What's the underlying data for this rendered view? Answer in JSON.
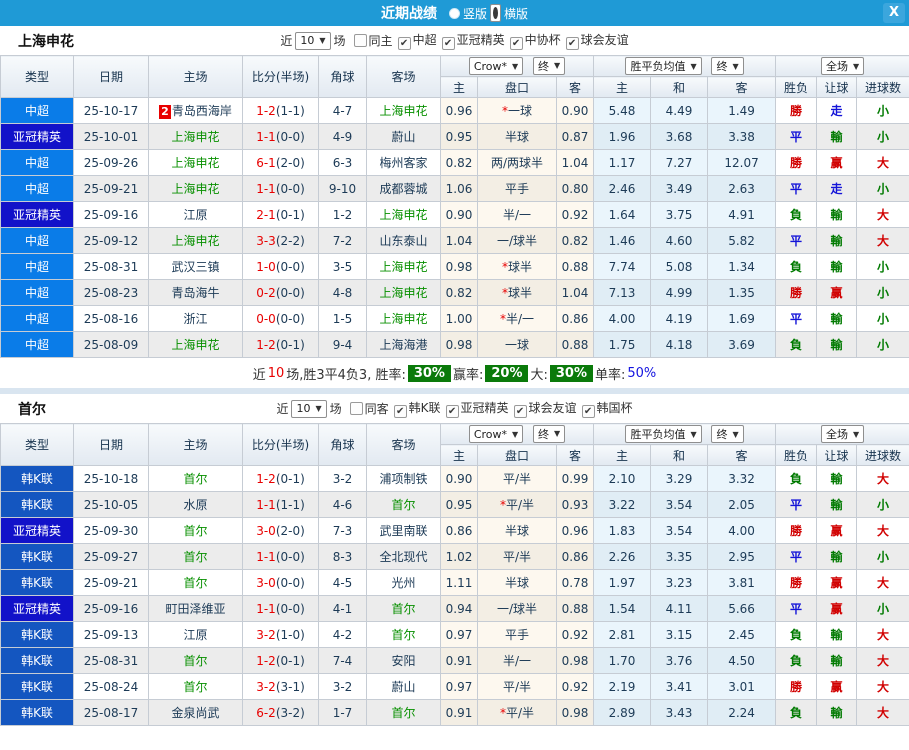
{
  "icons": {
    "dropdown_arrow": "▼",
    "close": "X",
    "check": "✔"
  },
  "topbar": {
    "title": "近期战绩",
    "vertical_label": "竖版",
    "horizontal_label": "横版"
  },
  "filter": {
    "near": "近",
    "count": "10",
    "games": "场"
  },
  "columns": {
    "type": "类型",
    "date": "日期",
    "home": "主场",
    "score": "比分(半场)",
    "corner": "角球",
    "away": "客场",
    "bookmaker": "Crow*",
    "final": "终",
    "mean": "胜平负均值",
    "scope": "全场",
    "odds_home": "主",
    "handicap": "盘口",
    "odds_away": "客",
    "mean_home": "主",
    "mean_draw": "和",
    "mean_away": "客",
    "result": "胜负",
    "handicap_result": "让球",
    "goals": "进球数"
  },
  "colors": {
    "topbar": "#1f9ad6",
    "types": {
      "中超": "#0a7ce8",
      "亚冠精英": "#1212c9",
      "韩K联": "#1456c0"
    },
    "result": {
      "勝": "#d10000",
      "赢": "#d10000",
      "大": "#d10000",
      "平": "#1414d8",
      "走": "#1414d8",
      "負": "#007a00",
      "輸": "#007a00",
      "小": "#007a00"
    }
  },
  "sections": [
    {
      "team": "上海申花",
      "filter": {
        "same": "同主",
        "same_checked": false,
        "leagues": [
          "中超",
          "亚冠精英",
          "中协杯",
          "球会友谊"
        ]
      },
      "rows": [
        {
          "type": "中超",
          "date": "25-10-17",
          "badge": "2",
          "home": "青岛西海岸",
          "hg": false,
          "ft": "1-2",
          "ht": "(1-1)",
          "corner": "4-7",
          "away": "上海申花",
          "ag": true,
          "h": "0.96",
          "star": true,
          "hcap": "一球",
          "a": "0.90",
          "mh": "5.48",
          "md": "4.49",
          "ma": "1.49",
          "r1": "勝",
          "r2": "走",
          "r3": "小"
        },
        {
          "type": "亚冠精英",
          "date": "25-10-01",
          "home": "上海申花",
          "hg": true,
          "ft": "1-1",
          "ht": "(0-0)",
          "corner": "4-9",
          "away": "蔚山",
          "ag": false,
          "h": "0.95",
          "hcap": "半球",
          "a": "0.87",
          "mh": "1.96",
          "md": "3.68",
          "ma": "3.38",
          "r1": "平",
          "r2": "輸",
          "r3": "小"
        },
        {
          "type": "中超",
          "date": "25-09-26",
          "home": "上海申花",
          "hg": true,
          "ft": "6-1",
          "ht": "(2-0)",
          "corner": "6-3",
          "away": "梅州客家",
          "ag": false,
          "h": "0.82",
          "hcap": "两/两球半",
          "a": "1.04",
          "mh": "1.17",
          "md": "7.27",
          "ma": "12.07",
          "r1": "勝",
          "r2": "赢",
          "r3": "大"
        },
        {
          "type": "中超",
          "date": "25-09-21",
          "home": "上海申花",
          "hg": true,
          "ft": "1-1",
          "ht": "(0-0)",
          "corner": "9-10",
          "away": "成都蓉城",
          "ag": false,
          "h": "1.06",
          "hcap": "平手",
          "a": "0.80",
          "mh": "2.46",
          "md": "3.49",
          "ma": "2.63",
          "r1": "平",
          "r2": "走",
          "r3": "小"
        },
        {
          "type": "亚冠精英",
          "date": "25-09-16",
          "home": "江原",
          "hg": false,
          "ft": "2-1",
          "ht": "(0-1)",
          "corner": "1-2",
          "away": "上海申花",
          "ag": true,
          "h": "0.90",
          "hcap": "半/一",
          "a": "0.92",
          "mh": "1.64",
          "md": "3.75",
          "ma": "4.91",
          "r1": "負",
          "r2": "輸",
          "r3": "大"
        },
        {
          "type": "中超",
          "date": "25-09-12",
          "home": "上海申花",
          "hg": true,
          "ft": "3-3",
          "ht": "(2-2)",
          "corner": "7-2",
          "away": "山东泰山",
          "ag": false,
          "h": "1.04",
          "hcap": "一/球半",
          "a": "0.82",
          "mh": "1.46",
          "md": "4.60",
          "ma": "5.82",
          "r1": "平",
          "r2": "輸",
          "r3": "大"
        },
        {
          "type": "中超",
          "date": "25-08-31",
          "home": "武汉三镇",
          "hg": false,
          "ft": "1-0",
          "ht": "(0-0)",
          "corner": "3-5",
          "away": "上海申花",
          "ag": true,
          "h": "0.98",
          "star": true,
          "hcap": "球半",
          "a": "0.88",
          "mh": "7.74",
          "md": "5.08",
          "ma": "1.34",
          "r1": "負",
          "r2": "輸",
          "r3": "小"
        },
        {
          "type": "中超",
          "date": "25-08-23",
          "home": "青岛海牛",
          "hg": false,
          "ft": "0-2",
          "ht": "(0-0)",
          "corner": "4-8",
          "away": "上海申花",
          "ag": true,
          "h": "0.82",
          "star": true,
          "hcap": "球半",
          "a": "1.04",
          "mh": "7.13",
          "md": "4.99",
          "ma": "1.35",
          "r1": "勝",
          "r2": "赢",
          "r3": "小"
        },
        {
          "type": "中超",
          "date": "25-08-16",
          "home": "浙江",
          "hg": false,
          "ft": "0-0",
          "ht": "(0-0)",
          "corner": "1-5",
          "away": "上海申花",
          "ag": true,
          "h": "1.00",
          "star": true,
          "hcap": "半/一",
          "a": "0.86",
          "mh": "4.00",
          "md": "4.19",
          "ma": "1.69",
          "r1": "平",
          "r2": "輸",
          "r3": "小"
        },
        {
          "type": "中超",
          "date": "25-08-09",
          "home": "上海申花",
          "hg": true,
          "ft": "1-2",
          "ht": "(0-1)",
          "corner": "9-4",
          "away": "上海海港",
          "ag": false,
          "h": "0.98",
          "hcap": "一球",
          "a": "0.88",
          "mh": "1.75",
          "md": "4.18",
          "ma": "3.69",
          "r1": "負",
          "r2": "輸",
          "r3": "小"
        }
      ],
      "summary": {
        "t1": "近",
        "count": "10",
        "t2": "场,胜3平4负3, 胜率:",
        "win": "30%",
        "t3": "赢率:",
        "profit": "20%",
        "t4": "大:",
        "big": "30%",
        "t5": "单率:",
        "single": "50%"
      }
    },
    {
      "team": "首尔",
      "filter": {
        "same": "同客",
        "same_checked": false,
        "leagues": [
          "韩K联",
          "亚冠精英",
          "球会友谊",
          "韩国杯"
        ]
      },
      "rows": [
        {
          "type": "韩K联",
          "date": "25-10-18",
          "home": "首尔",
          "hg": true,
          "ft": "1-2",
          "ht": "(0-1)",
          "corner": "3-2",
          "away": "浦项制铁",
          "ag": false,
          "h": "0.90",
          "hcap": "平/半",
          "a": "0.99",
          "mh": "2.10",
          "md": "3.29",
          "ma": "3.32",
          "r1": "負",
          "r2": "輸",
          "r3": "大"
        },
        {
          "type": "韩K联",
          "date": "25-10-05",
          "home": "水原",
          "hg": false,
          "ft": "1-1",
          "ht": "(1-1)",
          "corner": "4-6",
          "away": "首尔",
          "ag": true,
          "h": "0.95",
          "star": true,
          "hcap": "平/半",
          "a": "0.93",
          "mh": "3.22",
          "md": "3.54",
          "ma": "2.05",
          "r1": "平",
          "r2": "輸",
          "r3": "小"
        },
        {
          "type": "亚冠精英",
          "date": "25-09-30",
          "home": "首尔",
          "hg": true,
          "ft": "3-0",
          "ht": "(2-0)",
          "corner": "7-3",
          "away": "武里南联",
          "ag": false,
          "h": "0.86",
          "hcap": "半球",
          "a": "0.96",
          "mh": "1.83",
          "md": "3.54",
          "ma": "4.00",
          "r1": "勝",
          "r2": "赢",
          "r3": "大"
        },
        {
          "type": "韩K联",
          "date": "25-09-27",
          "home": "首尔",
          "hg": true,
          "ft": "1-1",
          "ht": "(0-0)",
          "corner": "8-3",
          "away": "全北现代",
          "ag": false,
          "h": "1.02",
          "hcap": "平/半",
          "a": "0.86",
          "mh": "2.26",
          "md": "3.35",
          "ma": "2.95",
          "r1": "平",
          "r2": "輸",
          "r3": "小"
        },
        {
          "type": "韩K联",
          "date": "25-09-21",
          "home": "首尔",
          "hg": true,
          "ft": "3-0",
          "ht": "(0-0)",
          "corner": "4-5",
          "away": "光州",
          "ag": false,
          "h": "1.11",
          "hcap": "半球",
          "a": "0.78",
          "mh": "1.97",
          "md": "3.23",
          "ma": "3.81",
          "r1": "勝",
          "r2": "赢",
          "r3": "大"
        },
        {
          "type": "亚冠精英",
          "date": "25-09-16",
          "home": "町田泽维亚",
          "hg": false,
          "ft": "1-1",
          "ht": "(0-0)",
          "corner": "4-1",
          "away": "首尔",
          "ag": true,
          "h": "0.94",
          "hcap": "一/球半",
          "a": "0.88",
          "mh": "1.54",
          "md": "4.11",
          "ma": "5.66",
          "r1": "平",
          "r2": "赢",
          "r3": "小"
        },
        {
          "type": "韩K联",
          "date": "25-09-13",
          "home": "江原",
          "hg": false,
          "ft": "3-2",
          "ht": "(1-0)",
          "corner": "4-2",
          "away": "首尔",
          "ag": true,
          "h": "0.97",
          "hcap": "平手",
          "a": "0.92",
          "mh": "2.81",
          "md": "3.15",
          "ma": "2.45",
          "r1": "負",
          "r2": "輸",
          "r3": "大"
        },
        {
          "type": "韩K联",
          "date": "25-08-31",
          "home": "首尔",
          "hg": true,
          "ft": "1-2",
          "ht": "(0-1)",
          "corner": "7-4",
          "away": "安阳",
          "ag": false,
          "h": "0.91",
          "hcap": "半/一",
          "a": "0.98",
          "mh": "1.70",
          "md": "3.76",
          "ma": "4.50",
          "r1": "負",
          "r2": "輸",
          "r3": "大"
        },
        {
          "type": "韩K联",
          "date": "25-08-24",
          "home": "首尔",
          "hg": true,
          "ft": "3-2",
          "ht": "(3-1)",
          "corner": "3-2",
          "away": "蔚山",
          "ag": false,
          "h": "0.97",
          "hcap": "平/半",
          "a": "0.92",
          "mh": "2.19",
          "md": "3.41",
          "ma": "3.01",
          "r1": "勝",
          "r2": "赢",
          "r3": "大"
        },
        {
          "type": "韩K联",
          "date": "25-08-17",
          "home": "金泉尚武",
          "hg": false,
          "ft": "6-2",
          "ht": "(3-2)",
          "corner": "1-7",
          "away": "首尔",
          "ag": true,
          "h": "0.91",
          "star": true,
          "hcap": "平/半",
          "a": "0.98",
          "mh": "2.89",
          "md": "3.43",
          "ma": "2.24",
          "r1": "負",
          "r2": "輸",
          "r3": "大"
        }
      ]
    }
  ]
}
